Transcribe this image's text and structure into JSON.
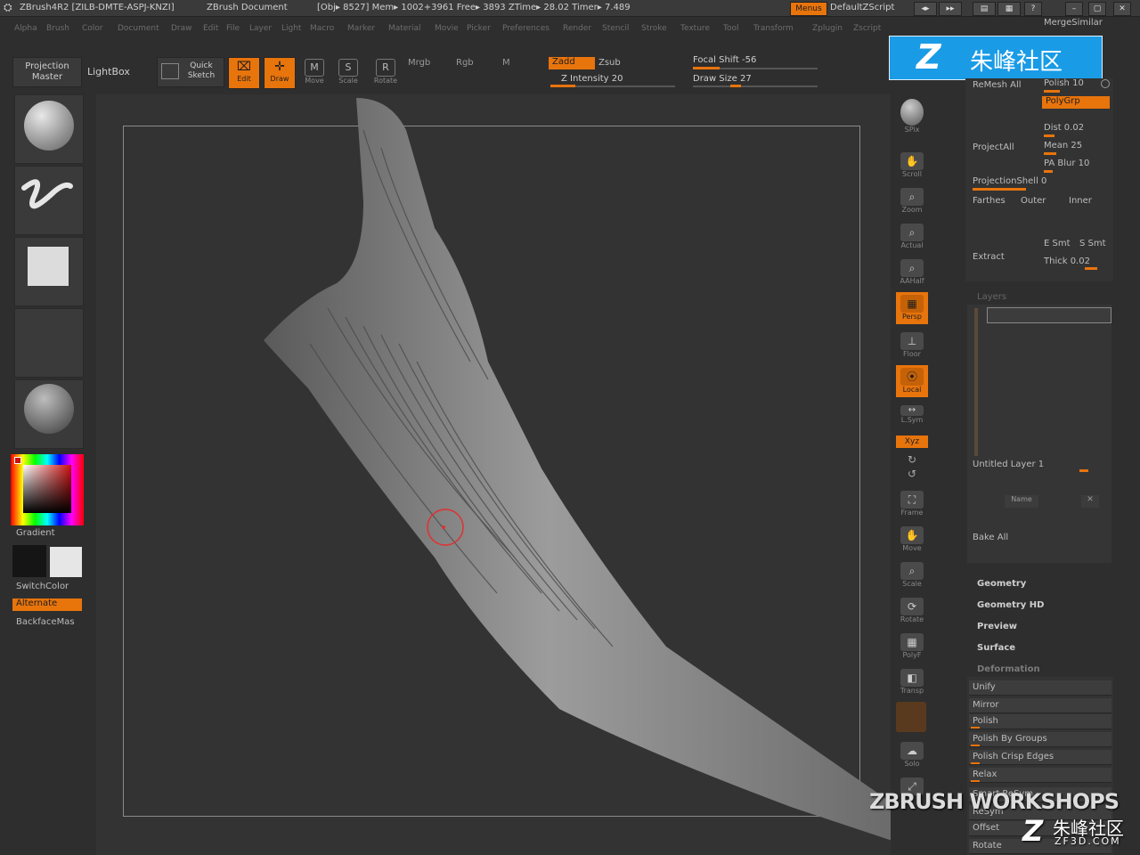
{
  "titlebar": {
    "app": "ZBrush4R2  [ZILB-DMTE-ASPJ-KNZI]",
    "document": "ZBrush Document",
    "stats": "[Obj▸ 8527]  Mem▸ 1002+3961  Free▸ 3893  ZTime▸ 28.02  Timer▸ 7.489",
    "menus_button": "Menus",
    "script": "DefaultZScript"
  },
  "menu": [
    "Alpha",
    "Brush",
    "Color",
    "Document",
    "Draw",
    "Edit",
    "File",
    "Layer",
    "Light",
    "Macro",
    "Marker",
    "Material",
    "Movie",
    "Picker",
    "Preferences",
    "Render",
    "Stencil",
    "Stroke",
    "Texture",
    "Tool",
    "Transform",
    "Zplugin",
    "Zscript"
  ],
  "shelf": {
    "projection_master": "Projection Master",
    "lightbox": "LightBox",
    "quick_sketch": "Quick Sketch",
    "edit": "Edit",
    "draw": "Draw",
    "move": "Move",
    "scale": "Scale",
    "rotate": "Rotate",
    "mrgb": "Mrgb",
    "rgb": "Rgb",
    "m": "M",
    "zadd": "Zadd",
    "zsub": "Zsub",
    "z_intensity": "Z Intensity 20",
    "focal_shift": "Focal Shift -56",
    "draw_size": "Draw Size 27"
  },
  "left_tray": {
    "gradient": "Gradient",
    "switchcolor": "SwitchColor",
    "alternate": "Alternate",
    "backfacemask": "BackfaceMas"
  },
  "right_shelf": [
    "SPix",
    "Scroll",
    "Zoom",
    "Actual",
    "AAHalf",
    "Persp",
    "Floor",
    "Local",
    "L.Sym",
    "Xyz",
    "Frame",
    "Move",
    "Scale",
    "Rotate",
    "PolyF",
    "Transp",
    "Solo"
  ],
  "panel": {
    "merge_similar": "MergeSimilar",
    "remesh_all": "ReMesh All",
    "polish_10": "Polish 10",
    "polygrp": "PolyGrp",
    "dist": "Dist 0.02",
    "mean": "Mean 25",
    "pa_blur": "PA Blur 10",
    "project_all": "ProjectAll",
    "projection_shell": "ProjectionShell 0",
    "farthest": "Farthes",
    "outer": "Outer",
    "inner": "Inner",
    "extract": "Extract",
    "e_smt": "E Smt",
    "s_smt": "S Smt",
    "thick": "Thick 0.02",
    "layers": "Layers",
    "untitled_layer": "Untitled Layer 1",
    "name": "Name",
    "bake_all": "Bake All",
    "geometry": "Geometry",
    "geometry_hd": "Geometry HD",
    "preview": "Preview",
    "surface": "Surface",
    "deformation": "Deformation",
    "deform_items": [
      "Unify",
      "Mirror",
      "Polish",
      "Polish By Groups",
      "Polish Crisp Edges",
      "Relax",
      "Smart ReSym",
      "ReSym",
      "Offset",
      "Rotate"
    ]
  },
  "watermark": {
    "logo_text": "朱峰社区",
    "workshops": "ZBRUSH WORKSHOPS",
    "corner_text": "朱峰社区",
    "corner_url": "ZF3D.COM"
  },
  "colors": {
    "accent": "#e8740c",
    "background": "#2e2e2e",
    "logo_blue": "#1a9be6"
  }
}
